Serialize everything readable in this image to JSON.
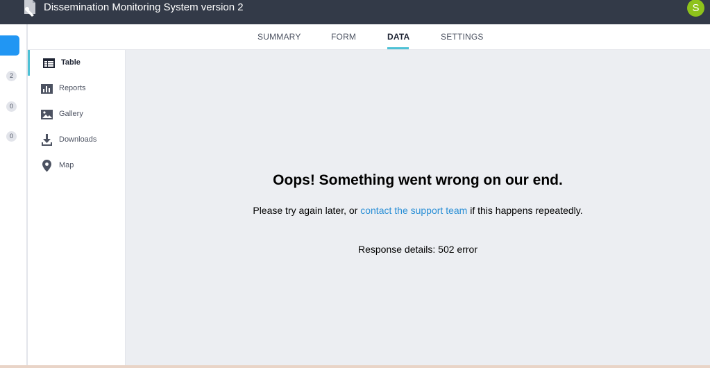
{
  "app": {
    "title": "Dissemination Monitoring System version 2",
    "logo_icon": "project-document-icon",
    "user_initial": "S",
    "avatar_color": "#8ec21b"
  },
  "rail": {
    "badges": [
      "2",
      "0",
      "0"
    ],
    "button_color": "#2196f3"
  },
  "tabs": [
    {
      "label": "SUMMARY",
      "active": false
    },
    {
      "label": "FORM",
      "active": false
    },
    {
      "label": "DATA",
      "active": true
    },
    {
      "label": "SETTINGS",
      "active": false
    }
  ],
  "sidebar": {
    "items": [
      {
        "label": "Table",
        "icon": "table-icon",
        "active": true
      },
      {
        "label": "Reports",
        "icon": "bar-chart-icon",
        "active": false
      },
      {
        "label": "Gallery",
        "icon": "image-icon",
        "active": false
      },
      {
        "label": "Downloads",
        "icon": "download-icon",
        "active": false
      },
      {
        "label": "Map",
        "icon": "map-pin-icon",
        "active": false
      }
    ]
  },
  "error": {
    "title": "Oops! Something went wrong on our end.",
    "message_before": "Please try again later, or ",
    "link_text": "contact the support team",
    "message_after": " if this happens repeatedly.",
    "details": "Response details: 502 error"
  },
  "colors": {
    "header_bg": "#333a48",
    "accent": "#4ec1d5",
    "link": "#2a8fd6",
    "main_bg": "#eceef2"
  }
}
